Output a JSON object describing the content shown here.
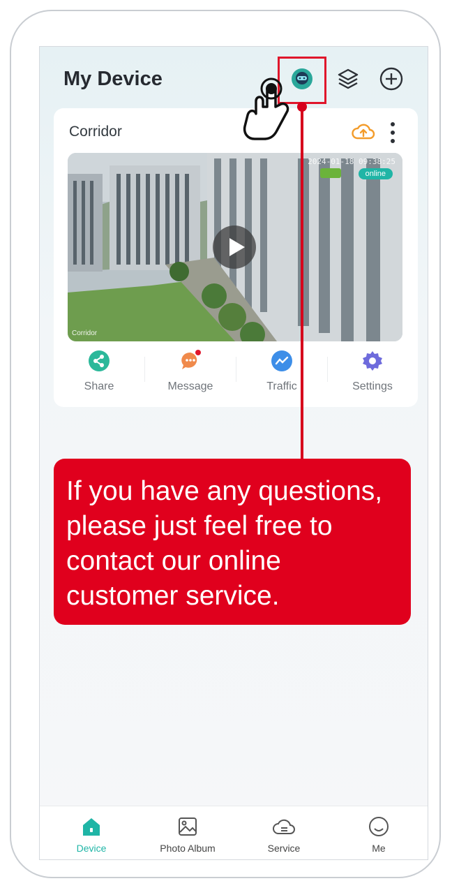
{
  "header": {
    "title": "My Device",
    "icons": [
      "customer-service-icon",
      "layers-icon",
      "add-circle-icon"
    ]
  },
  "device": {
    "name": "Corridor",
    "timestamp": "2024-01-18 09:38:25",
    "status": "online",
    "camera_label": "Corridor"
  },
  "actions": [
    {
      "label": "Share",
      "icon": "share-icon",
      "color": "#2bb89a"
    },
    {
      "label": "Message",
      "icon": "message-icon",
      "color": "#f08a4b"
    },
    {
      "label": "Traffic",
      "icon": "traffic-icon",
      "color": "#3d8ee8"
    },
    {
      "label": "Settings",
      "icon": "gear-icon",
      "color": "#6e6bdc"
    }
  ],
  "tooltip": {
    "lines": [
      "If you have any questions,",
      "please just feel free to",
      "contact our online",
      "customer service."
    ]
  },
  "tabs": [
    {
      "label": "Device",
      "icon": "home-icon",
      "active": true
    },
    {
      "label": "Photo Album",
      "icon": "photo-icon",
      "active": false
    },
    {
      "label": "Service",
      "icon": "cloud-icon",
      "active": false
    },
    {
      "label": "Me",
      "icon": "smile-icon",
      "active": false
    }
  ],
  "colors": {
    "accent": "#1fb5a6",
    "highlight": "#e0162b",
    "tooltip_bg": "#e0001d",
    "upload": "#f39c2b"
  }
}
